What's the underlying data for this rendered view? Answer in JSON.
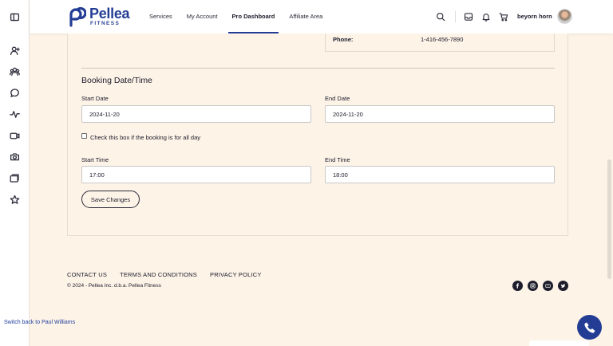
{
  "header": {
    "logo_name": "Pellea",
    "logo_sub": "FITNESS",
    "nav": [
      {
        "label": "Services"
      },
      {
        "label": "My Account"
      },
      {
        "label": "Pro Dashboard"
      },
      {
        "label": "Affiliate Area"
      }
    ],
    "user_name": "beyorn horn"
  },
  "contact": {
    "phone_label": "Phone:",
    "phone_value": "1-416-456-7890"
  },
  "booking": {
    "title": "Booking Date/Time",
    "start_date_label": "Start Date",
    "start_date_value": "2024-11-20",
    "end_date_label": "End Date",
    "end_date_value": "2024-11-20",
    "all_day_label": "Check this box if the booking is for all day",
    "all_day_checked": false,
    "start_time_label": "Start Time",
    "start_time_value": "17:00",
    "end_time_label": "End Time",
    "end_time_value": "18:00",
    "save_label": "Save Changes"
  },
  "footer": {
    "links": [
      {
        "label": "CONTACT US"
      },
      {
        "label": "TERMS AND CONDITIONS"
      },
      {
        "label": "PRIVACY POLICY"
      }
    ],
    "copyright": "© 2024 - Pellea Inc. d.b.a. Pellea Fitness",
    "socials": [
      "facebook-icon",
      "instagram-icon",
      "youtube-icon",
      "twitter-icon"
    ]
  },
  "switch_back": "Switch back to Paul Williams",
  "colors": {
    "brand": "#233d95",
    "background": "#fdf3e7",
    "text": "#1a1a2a"
  },
  "rail_icons": [
    "sidebar-toggle-icon",
    "user-add-icon",
    "users-icon",
    "chat-icon",
    "activity-icon",
    "video-icon",
    "camera-icon",
    "gallery-icon",
    "star-icon"
  ]
}
